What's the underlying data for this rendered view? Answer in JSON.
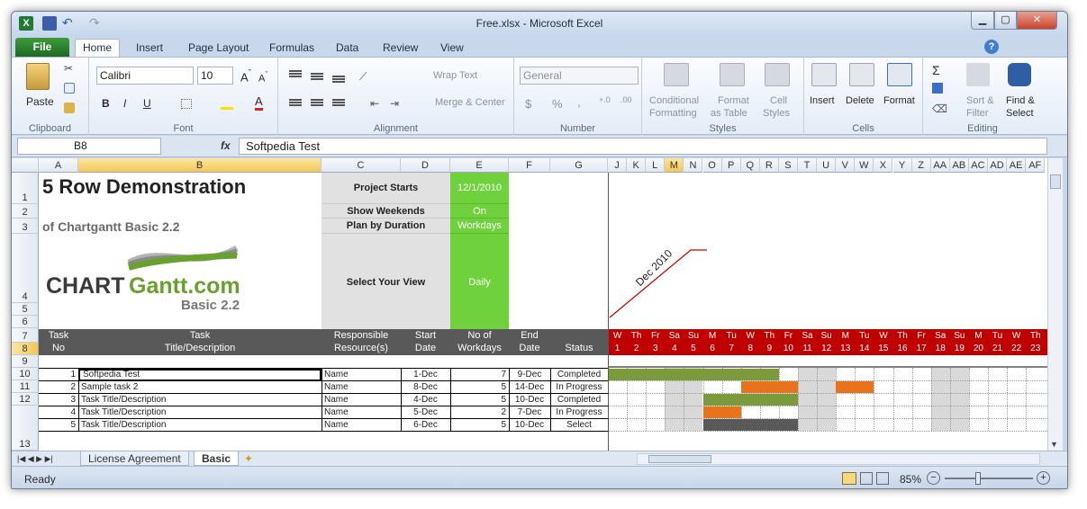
{
  "window": {
    "title": "Free.xlsx - Microsoft Excel"
  },
  "ribbon_tabs": [
    "File",
    "Home",
    "Insert",
    "Page Layout",
    "Formulas",
    "Data",
    "Review",
    "View"
  ],
  "clipboard": {
    "paste": "Paste",
    "label": "Clipboard"
  },
  "font": {
    "name": "Calibri",
    "size": "10",
    "label": "Font"
  },
  "alignment": {
    "wrap": "Wrap Text",
    "merge": "Merge & Center",
    "label": "Alignment"
  },
  "number": {
    "format": "General",
    "label": "Number"
  },
  "styles": {
    "conditional": "Conditional",
    "formatting": "Formatting",
    "format_as": "Format",
    "as_table": "as Table",
    "cell": "Cell",
    "cell_styles": "Styles",
    "label": "Styles"
  },
  "cells": {
    "insert": "Insert",
    "delete": "Delete",
    "format": "Format",
    "label": "Cells"
  },
  "editing": {
    "sort": "Sort &",
    "filter": "Filter",
    "find": "Find &",
    "select": "Select",
    "label": "Editing"
  },
  "formula_bar": {
    "name_box": "B8",
    "fx": "fx",
    "content": "Softpedia Test"
  },
  "columns_left": [
    "A",
    "B",
    "C",
    "D",
    "E",
    "F",
    "G"
  ],
  "columns_gantt": [
    "J",
    "K",
    "L",
    "M",
    "N",
    "O",
    "P",
    "Q",
    "R",
    "S",
    "T",
    "U",
    "V",
    "W",
    "X",
    "Y",
    "Z",
    "AA",
    "AB",
    "AC",
    "AD",
    "AE",
    "AF"
  ],
  "rows": [
    "1",
    "2",
    "3",
    "4",
    "5",
    "6",
    "7",
    "8",
    "9",
    "10",
    "11",
    "12",
    "13"
  ],
  "header_block": {
    "title": "5 Row Demonstration",
    "subtitle": "of Chartgantt Basic 2.2",
    "logo_chart": "CHART",
    "logo_gantt": "Gantt.com",
    "logo_basic": "Basic 2.2",
    "project_starts": "Project Starts",
    "project_starts_val": "12/1/2010",
    "show_weekends": "Show Weekends",
    "show_weekends_val": "On",
    "plan_by": "Plan by Duration",
    "plan_by_val": "Workdays",
    "select_view": "Select Your View",
    "select_view_val": "Daily",
    "month_label": "Dec 2010"
  },
  "table_headers": {
    "task_no_1": "Task",
    "task_no_2": "No",
    "title_1": "Task",
    "title_2": "Title/Description",
    "res_1": "Responsible",
    "res_2": "Resource(s)",
    "start_1": "Start",
    "start_2": "Date",
    "workdays_1": "No of",
    "workdays_2": "Workdays",
    "end_1": "End",
    "end_2": "Date",
    "status": "Status"
  },
  "days": [
    "W",
    "Th",
    "Fr",
    "Sa",
    "Su",
    "M",
    "Tu",
    "W",
    "Th",
    "Fr",
    "Sa",
    "Su",
    "M",
    "Tu",
    "W",
    "Th",
    "Fr",
    "Sa",
    "Su",
    "M",
    "Tu",
    "W",
    "Th"
  ],
  "dates": [
    "1",
    "2",
    "3",
    "4",
    "5",
    "6",
    "7",
    "8",
    "9",
    "10",
    "11",
    "12",
    "13",
    "14",
    "15",
    "16",
    "17",
    "18",
    "19",
    "20",
    "21",
    "22",
    "23"
  ],
  "tasks": [
    {
      "no": "1",
      "title": "Softpedia Test",
      "resource": "Name",
      "start": "1-Dec",
      "workdays": "7",
      "end": "9-Dec",
      "status": "Completed"
    },
    {
      "no": "2",
      "title": "Sample task 2",
      "resource": "Name",
      "start": "8-Dec",
      "workdays": "5",
      "end": "14-Dec",
      "status": "In Progress"
    },
    {
      "no": "3",
      "title": "Task Title/Description",
      "resource": "Name",
      "start": "4-Dec",
      "workdays": "5",
      "end": "10-Dec",
      "status": "Completed"
    },
    {
      "no": "4",
      "title": "Task Title/Description",
      "resource": "Name",
      "start": "5-Dec",
      "workdays": "2",
      "end": "7-Dec",
      "status": "In Progress"
    },
    {
      "no": "5",
      "title": "Task Title/Description",
      "resource": "Name",
      "start": "6-Dec",
      "workdays": "5",
      "end": "10-Dec",
      "status": "Select"
    }
  ],
  "gantt_bars": [
    {
      "row": 0,
      "segments": [
        [
          1,
          9,
          "completed"
        ]
      ]
    },
    {
      "row": 1,
      "segments": [
        [
          8,
          10,
          "progress"
        ],
        [
          13,
          14,
          "progress"
        ]
      ]
    },
    {
      "row": 2,
      "segments": [
        [
          6,
          10,
          "completed"
        ]
      ]
    },
    {
      "row": 3,
      "segments": [
        [
          6,
          7,
          "progress"
        ]
      ]
    },
    {
      "row": 4,
      "segments": [
        [
          6,
          10,
          "select"
        ]
      ]
    }
  ],
  "bar_colors": {
    "completed": "#7a9a3c",
    "progress": "#e8731c",
    "select": "#595959"
  },
  "sheet_tabs": [
    "License Agreement",
    "Basic"
  ],
  "status": {
    "ready": "Ready",
    "zoom": "85%"
  }
}
